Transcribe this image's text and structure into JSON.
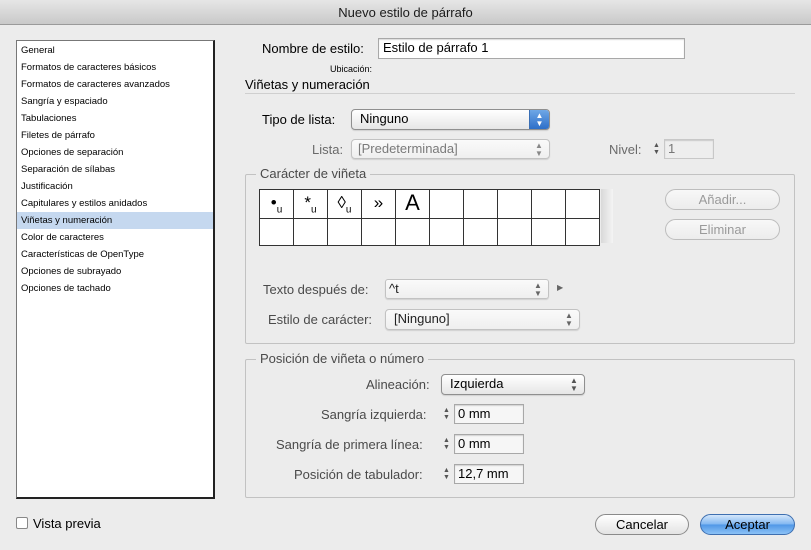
{
  "window": {
    "title": "Nuevo estilo de párrafo"
  },
  "sidebar": {
    "items": [
      "General",
      "Formatos de caracteres básicos",
      "Formatos de caracteres avanzados",
      "Sangría y espaciado",
      "Tabulaciones",
      "Filetes de párrafo",
      "Opciones de separación",
      "Separación de sílabas",
      "Justificación",
      "Capitulares y estilos anidados",
      "Viñetas y numeración",
      "Color de caracteres",
      "Características de OpenType",
      "Opciones de subrayado",
      "Opciones de tachado"
    ],
    "selected": "Viñetas y numeración"
  },
  "header": {
    "style_name_label": "Nombre de estilo:",
    "style_name_value": "Estilo de párrafo 1",
    "location_label": "Ubicación:",
    "section_title": "Viñetas y numeración"
  },
  "list": {
    "type_label": "Tipo de lista:",
    "type_value": "Ninguno",
    "list_label": "Lista:",
    "list_value": "[Predeterminada]",
    "level_label": "Nivel:",
    "level_value": "1"
  },
  "bullet": {
    "group_title": "Carácter de viñeta",
    "glyphs": [
      {
        "char": "•",
        "sub": "u"
      },
      {
        "char": "*",
        "sub": "u"
      },
      {
        "char": "◊",
        "sub": "u"
      },
      {
        "char": "»",
        "sub": ""
      },
      {
        "char": "A",
        "sub": ""
      }
    ],
    "add_label": "Añadir...",
    "remove_label": "Eliminar",
    "text_after_label": "Texto después de:",
    "text_after_value": "^t",
    "char_style_label": "Estilo de carácter:",
    "char_style_value": "[Ninguno]"
  },
  "position": {
    "group_title": "Posición de viñeta o número",
    "alignment_label": "Alineación:",
    "alignment_value": "Izquierda",
    "left_indent_label": "Sangría izquierda:",
    "left_indent_value": "0 mm",
    "first_line_label": "Sangría de primera línea:",
    "first_line_value": "0 mm",
    "tab_position_label": "Posición de tabulador:",
    "tab_position_value": "12,7 mm"
  },
  "footer": {
    "preview_label": "Vista previa",
    "cancel_label": "Cancelar",
    "accept_label": "Aceptar"
  },
  "colors": {
    "selected_row": "#c5d8ef",
    "default_button": "#4f96e6"
  }
}
